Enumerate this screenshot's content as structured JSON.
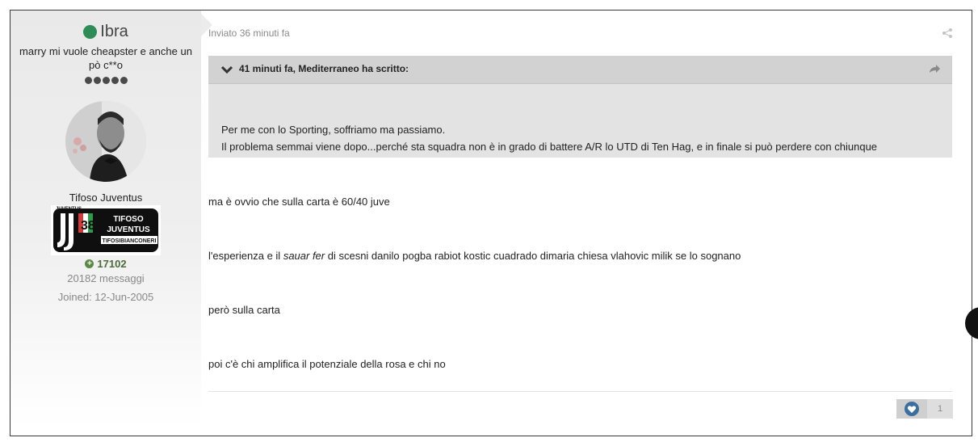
{
  "author": {
    "name": "Ibra",
    "online": true,
    "title": "marry mi vuole cheapster e anche un pò c**o",
    "pips": 5,
    "group": "Tifoso Juventus",
    "badge": {
      "top_text": "JUVENTUS",
      "line1": "TIFOSO",
      "line2": "JUVENTUS",
      "site": "TIFOSIBIANCONERI"
    },
    "reputation": "17102",
    "post_count": "20182 messaggi",
    "joined": "Joined: 12-Jun-2005"
  },
  "post": {
    "meta": "Inviato 36 minuti fa",
    "quote": {
      "citation": "41 minuti fa, Mediterraneo ha scritto:",
      "line1": "Per me con lo Sporting, soffriamo ma passiamo.",
      "line2": "Il problema semmai viene dopo...perché sta squadra non è in grado di battere A/R lo UTD di Ten Hag, e in finale si può perdere con chiunque"
    },
    "paragraphs": {
      "p1": "ma è ovvio che sulla carta è 60/40 juve",
      "p2_before": "l'esperienza e il ",
      "p2_em": "sauar fer",
      "p2_after": " di scesni danilo pogba rabiot kostic cuadrado dimaria chiesa vlahovic milik se lo sognano",
      "p3": "però sulla carta",
      "p4": "poi c'è chi amplifica il potenziale della rosa e chi no"
    },
    "reaction": {
      "icon": "heart-icon",
      "count": "1"
    }
  },
  "colors": {
    "online": "#2f8b57",
    "reputation": "#4a6b3a",
    "quote_bg": "#e3e3e3",
    "quote_header_bg": "#d2d2d2",
    "like_blue": "#3d6f9e"
  }
}
